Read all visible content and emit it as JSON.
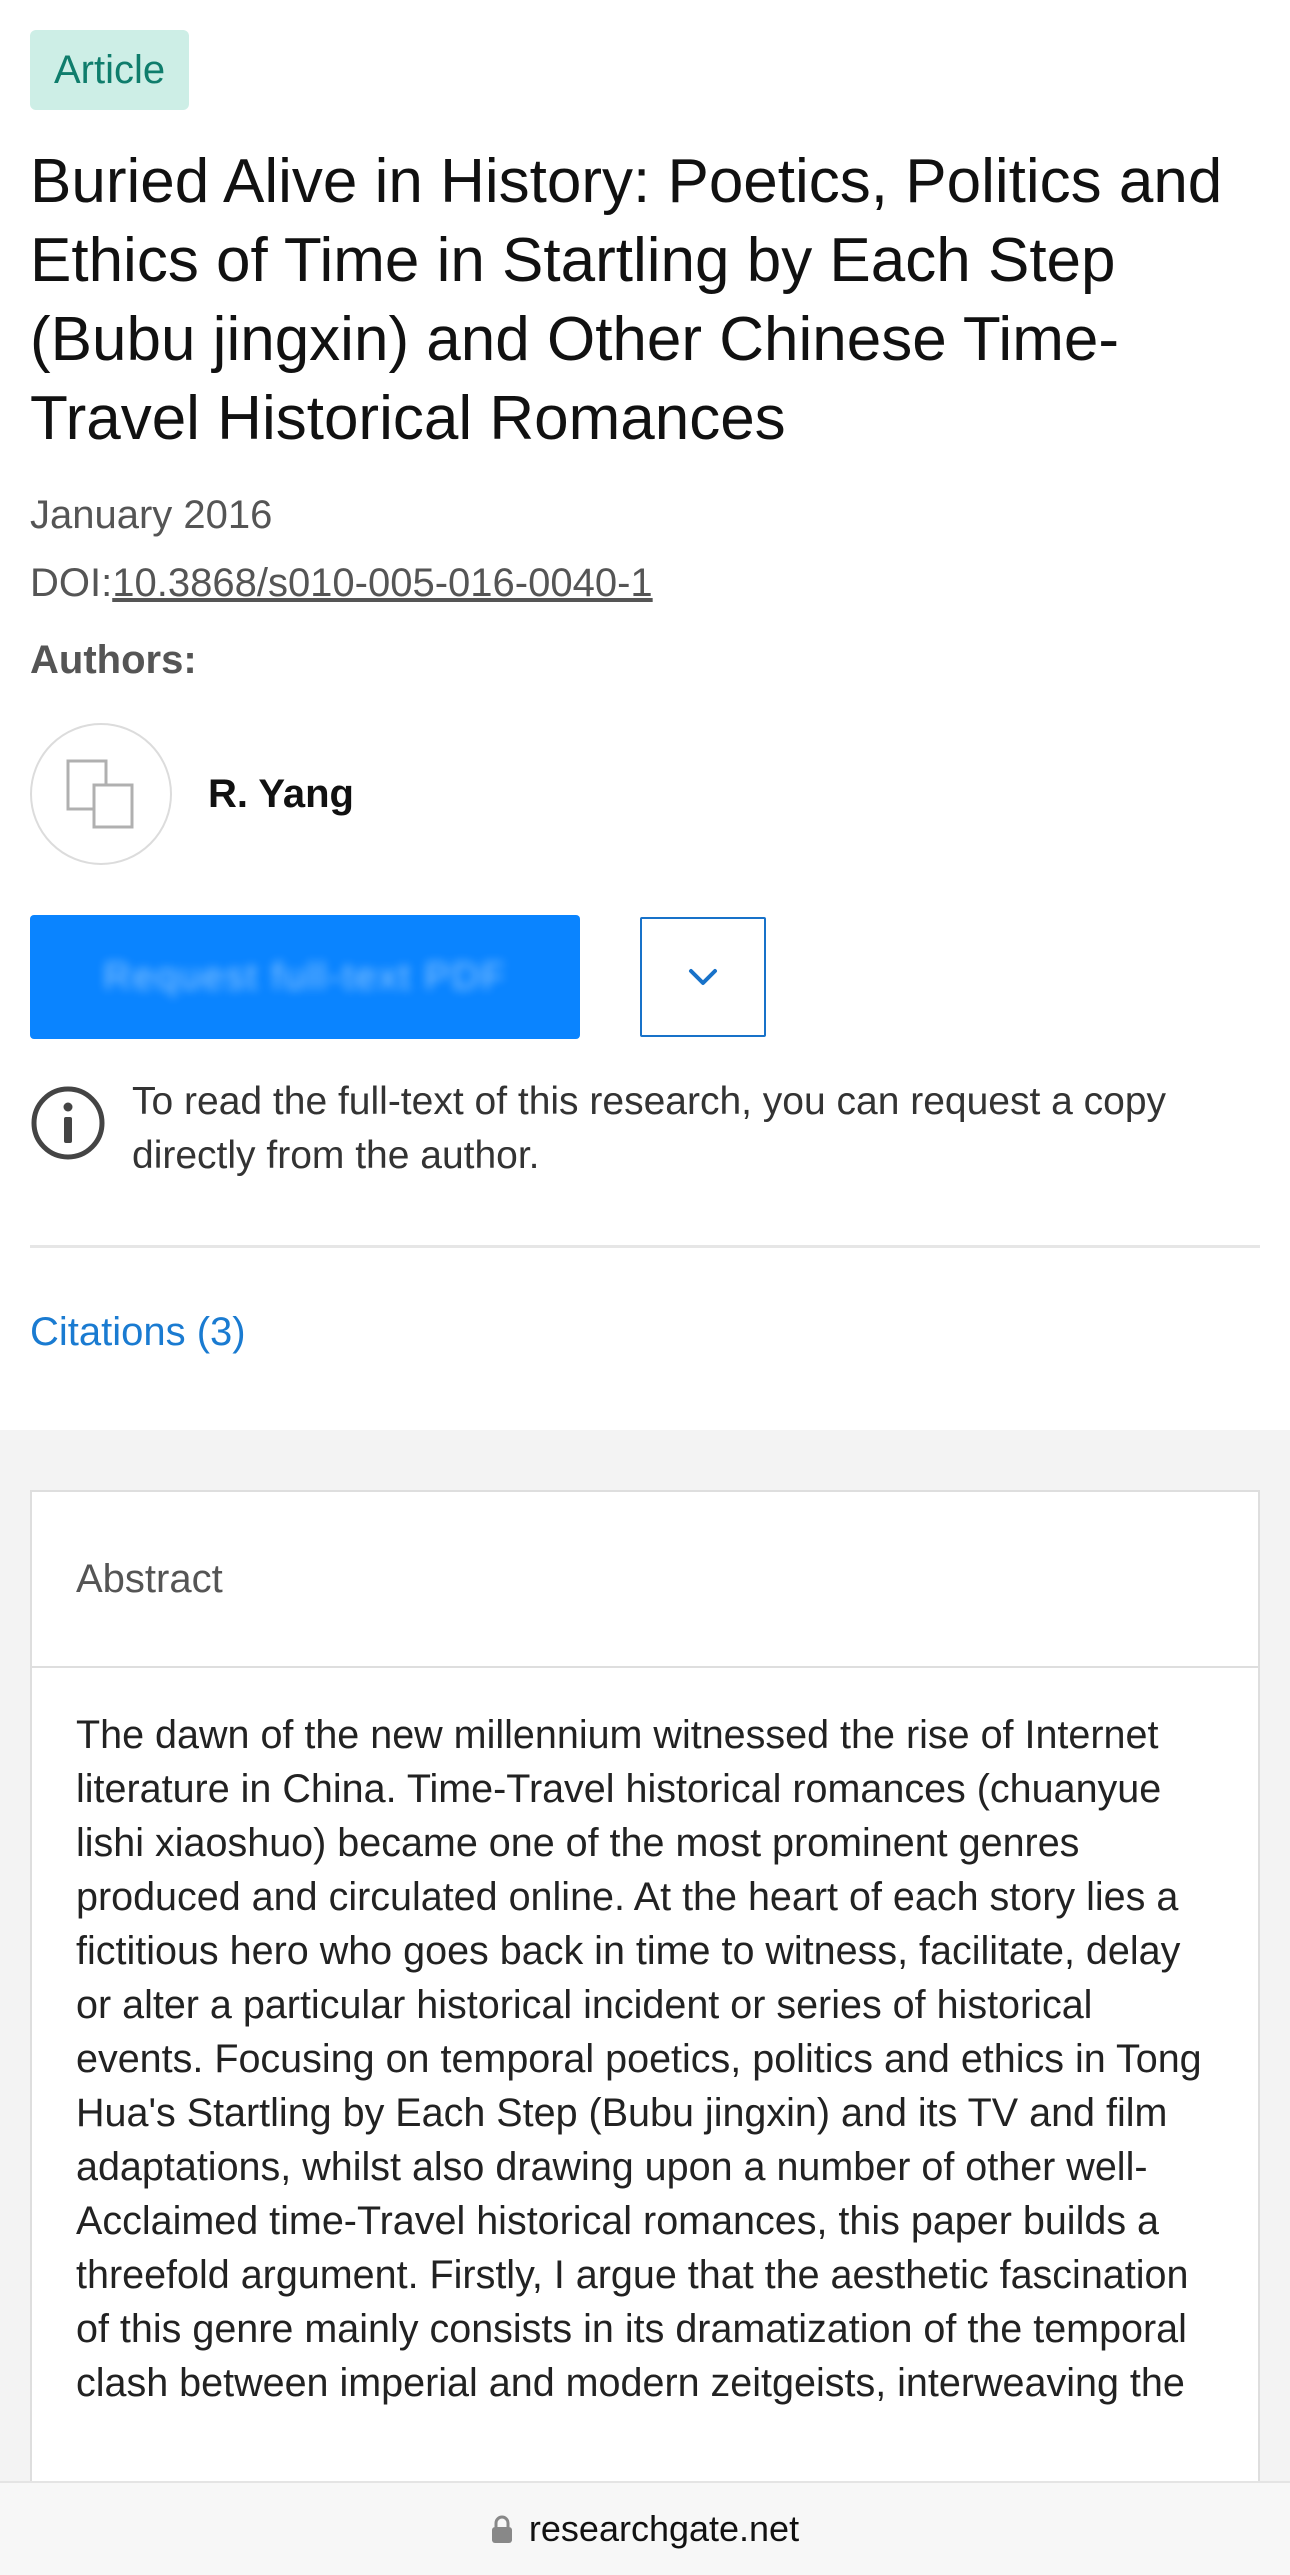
{
  "article": {
    "badge": "Article",
    "title": "Buried Alive in History: Poetics, Politics and Ethics of Time in Startling by Each Step (Bubu jingxin) and Other Chinese Time-Travel Historical Romances",
    "date": "January 2016",
    "doi_label": "DOI:",
    "doi_value": "10.3868/s010-005-016-0040-1"
  },
  "authors": {
    "label": "Authors:",
    "list": [
      {
        "name": "R. Yang"
      }
    ]
  },
  "actions": {
    "request_label": "Request full-text PDF"
  },
  "info": {
    "text": "To read the full-text of this research, you can request a copy directly from the author."
  },
  "citations": {
    "label": "Citations (3)"
  },
  "abstract": {
    "heading": "Abstract",
    "text": "The dawn of the new millennium witnessed the rise of Internet literature in China. Time-Travel historical romances (chuanyue lishi xiaoshuo) became one of the most prominent genres produced and circulated online. At the heart of each story lies a fictitious hero who goes back in time to witness, facilitate, delay or alter a particular historical incident or series of historical events. Focusing on temporal poetics, politics and ethics in Tong Hua's Startling by Each Step (Bubu jingxin) and its TV and film adaptations, whilst also drawing upon a number of other well-Acclaimed time-Travel historical romances, this paper builds a threefold argument. Firstly, I argue that the aesthetic fascination of this genre mainly consists in its dramatization of the temporal clash between imperial and modern zeitgeists, interweaving the"
  },
  "browser": {
    "domain": "researchgate.net"
  },
  "colors": {
    "badge_bg": "#cdeee6",
    "badge_text": "#0f7d6c",
    "primary_button": "#0a84ff",
    "link": "#1a7bd1"
  }
}
